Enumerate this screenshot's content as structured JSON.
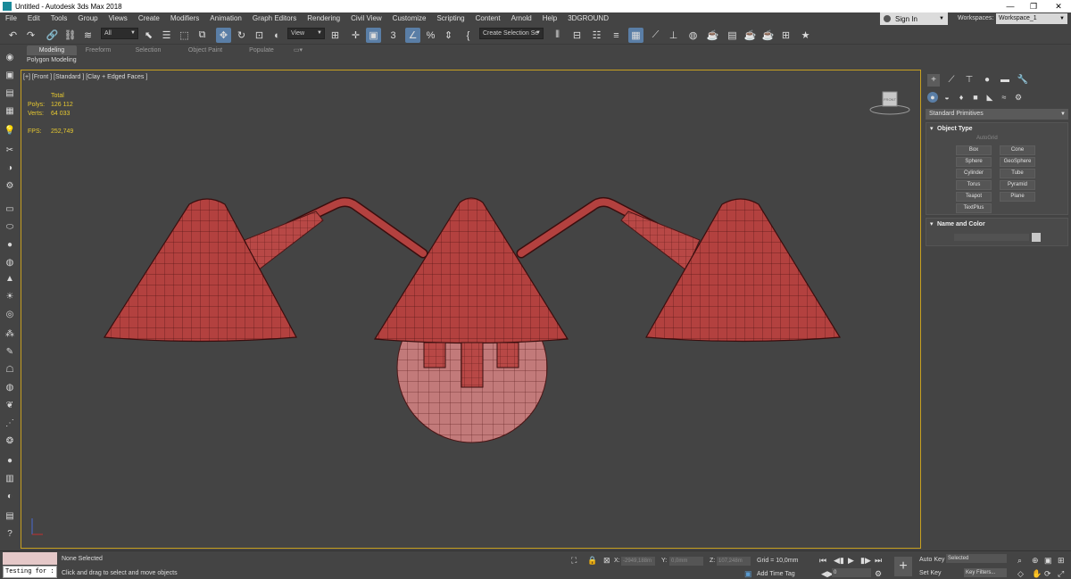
{
  "titlebar": {
    "title": "Untitled - Autodesk 3ds Max 2018",
    "minimize": "—",
    "maximize": "❐",
    "close": "✕"
  },
  "menubar": {
    "items": [
      "File",
      "Edit",
      "Tools",
      "Group",
      "Views",
      "Create",
      "Modifiers",
      "Animation",
      "Graph Editors",
      "Rendering",
      "Civil View",
      "Customize",
      "Scripting",
      "Content",
      "Arnold",
      "Help",
      "3DGROUND"
    ],
    "signin": "Sign In",
    "workspaces_label": "Workspaces:",
    "workspace_value": "Workspace_1"
  },
  "toolbar": {
    "selection_filter": "All",
    "ref_coord": "View",
    "selection_set": "Create Selection Se"
  },
  "ribbon": {
    "tabs": [
      "Modeling",
      "Freeform",
      "Selection",
      "Object Paint",
      "Populate"
    ],
    "active": "Modeling",
    "sub_label": "Polygon Modeling"
  },
  "viewport": {
    "label": "[+] [Front ] [Standard ] [Clay + Edged Faces ]",
    "stats": {
      "header": "Total",
      "polys_label": "Polys:",
      "polys": "126 112",
      "verts_label": "Verts:",
      "verts": "64 033",
      "fps_label": "FPS:",
      "fps": "252,749"
    },
    "viewcube_label": "FRONT"
  },
  "command_panel": {
    "dropdown": "Standard Primitives",
    "object_type": {
      "title": "Object Type",
      "autogrid": "AutoGrid",
      "buttons": [
        "Box",
        "Cone",
        "Sphere",
        "GeoSphere",
        "Cylinder",
        "Tube",
        "Torus",
        "Pyramid",
        "Teapot",
        "Plane",
        "TextPlus"
      ]
    },
    "name_color": {
      "title": "Name and Color",
      "swatch": "#c8c8c8"
    }
  },
  "status": {
    "listener": "Testing for :",
    "selection": "None Selected",
    "prompt": "Click and drag to select and move objects",
    "x_label": "X:",
    "x": "-2949,188m",
    "y_label": "Y:",
    "y": "0,0mm",
    "z_label": "Z:",
    "z": "107,248m",
    "grid": "Grid = 10,0mm",
    "add_time_tag": "Add Time Tag",
    "frame": "0",
    "auto_key": "Auto Key",
    "set_key": "Set Key",
    "key_select": "Selected",
    "key_filters": "Key Filters..."
  },
  "colors": {
    "accent": "#5a7ea6",
    "model_red": "#b3413f",
    "viewport_border": "#c8a020"
  }
}
